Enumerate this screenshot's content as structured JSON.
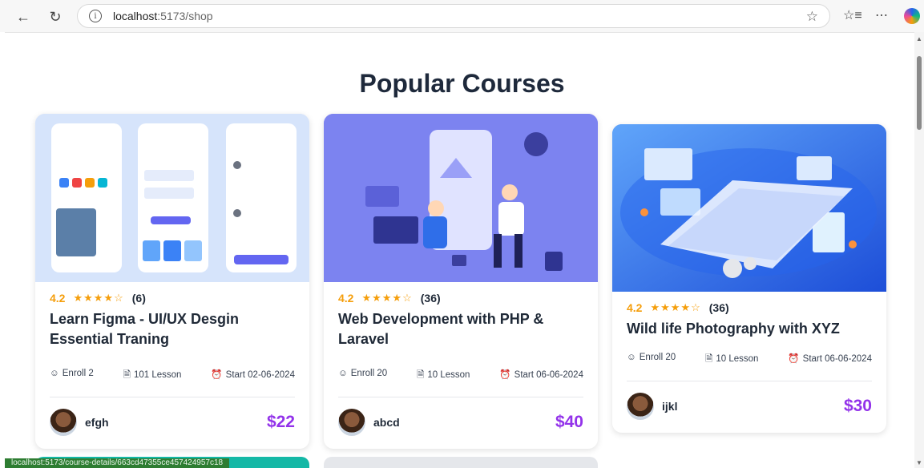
{
  "browser": {
    "url_host": "localhost",
    "url_path": ":5173/shop",
    "info_icon": "i"
  },
  "page": {
    "title": "Popular Courses"
  },
  "courses": [
    {
      "rating": "4.2",
      "stars": "★★★★☆",
      "reviews": "(6)",
      "title": "Learn Figma - UI/UX Desgin Essential Traning",
      "enroll": "Enroll 2",
      "lessons": "101 Lesson",
      "start": "Start 02-06-2024",
      "author": "efgh",
      "price": "$22",
      "thumb_color": "#cfe0fb"
    },
    {
      "rating": "4.2",
      "stars": "★★★★☆",
      "reviews": "(36)",
      "title": "Web Development with PHP & Laravel",
      "enroll": "Enroll 20",
      "lessons": "10 Lesson",
      "start": "Start 06-06-2024",
      "author": "abcd",
      "price": "$40",
      "thumb_color": "#7f86f2"
    },
    {
      "rating": "4.2",
      "stars": "★★★★☆",
      "reviews": "(36)",
      "title": "Wild life Photography with XYZ",
      "enroll": "Enroll 20",
      "lessons": "10 Lesson",
      "start": "Start 06-06-2024",
      "author": "ijkl",
      "price": "$30",
      "thumb_color": "#3b82f6"
    }
  ],
  "status_bar": {
    "link": "localhost:5173/course-details/663cd47355ce457424957c18"
  }
}
